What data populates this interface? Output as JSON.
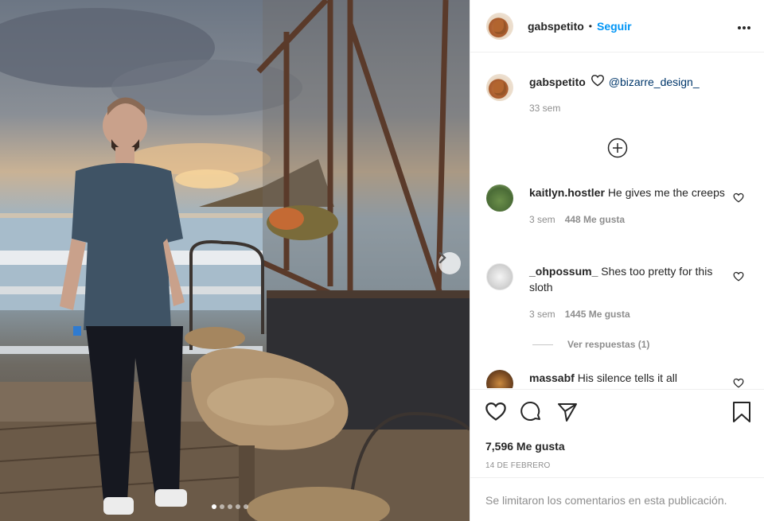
{
  "post": {
    "username": "gabspetito",
    "separator": "•",
    "follow_label": "Seguir",
    "more_icon": "more-horizontal-icon",
    "next_icon": "chevron-right-icon",
    "carousel": {
      "count": 5,
      "active": 1
    }
  },
  "caption": {
    "username": "gabspetito",
    "mention": "@bizarre_design_",
    "time": "33 sem"
  },
  "comments": [
    {
      "username": "kaitlyn.hostler",
      "text": "He gives me the creeps",
      "time": "3 sem",
      "likes": "448 Me gusta"
    },
    {
      "username": "_ohpossum_",
      "text": "Shes too pretty for this sloth",
      "time": "3 sem",
      "likes": "1445 Me gusta"
    },
    {
      "username": "massabf",
      "text": "His silence tells it all",
      "time": "",
      "likes": ""
    }
  ],
  "view_replies": "Ver respuestas (1)",
  "footer": {
    "likes": "7,596 Me gusta",
    "date": "14 DE FEBRERO",
    "comments_closed": "Se limitaron los comentarios en esta publicación."
  },
  "colors": {
    "accent": "#0095f6",
    "muted": "#8e8e8e",
    "text": "#262626"
  }
}
